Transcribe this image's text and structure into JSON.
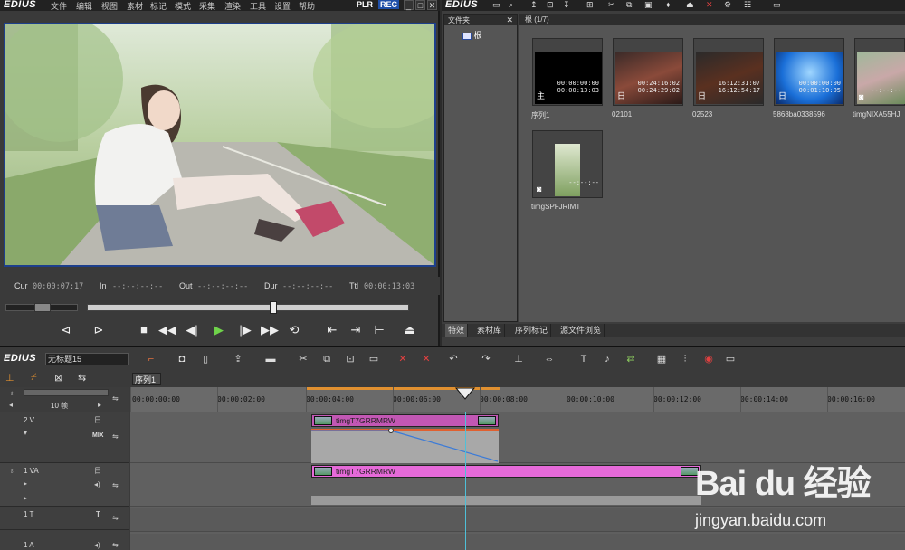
{
  "player": {
    "brand": "EDIUS",
    "menu": [
      "文件",
      "编辑",
      "视图",
      "素材",
      "标记",
      "模式",
      "采集",
      "渲染",
      "工具",
      "设置",
      "帮助"
    ],
    "plr": "PLR",
    "rec": "REC",
    "timecodes": [
      {
        "label": "Cur",
        "value": "00:00:07:17"
      },
      {
        "label": "In",
        "value": "--:--:--:--"
      },
      {
        "label": "Out",
        "value": "--:--:--:--"
      },
      {
        "label": "Dur",
        "value": "--:--:--:--"
      },
      {
        "label": "Ttl",
        "value": "00:00:13:03"
      }
    ]
  },
  "bin": {
    "brand": "EDIUS",
    "folder_header": "文件夹",
    "folder_root": "根",
    "bin_header": "根 (1/7)",
    "clips": [
      {
        "name": "序列1",
        "tc_top": "00:00:00:00",
        "tc_bottom": "00:00:13:03",
        "kind": "主"
      },
      {
        "name": "02101",
        "tc_top": "00:24:16:02",
        "tc_bottom": "00:24:29:02",
        "kind": "日"
      },
      {
        "name": "02523",
        "tc_top": "16:12:31:07",
        "tc_bottom": "16:12:54:17",
        "kind": "日"
      },
      {
        "name": "5868ba0338596",
        "tc_top": "00:00:00:00",
        "tc_bottom": "00:01:10:05",
        "kind": "日"
      },
      {
        "name": "timgNIXA55HJ",
        "tc_top": "",
        "tc_bottom": "--:--:--",
        "kind": "◙"
      },
      {
        "name": "timgSPFJRIMT",
        "tc_top": "",
        "tc_bottom": "--:--:--",
        "kind": "◙"
      }
    ],
    "tabs": [
      "特效",
      "素材库",
      "序列标记",
      "源文件浏览"
    ]
  },
  "timeline": {
    "brand": "EDIUS",
    "sequence_name": "无标题15",
    "sequence_tab": "序列1",
    "zoom_label": "10 帧",
    "ruler": [
      "00:00:00:00",
      "00:00:02:00",
      "00:00:04:00",
      "00:00:06:00",
      "00:00:08:00",
      "00:00:10:00",
      "00:00:12:00",
      "00:00:14:00",
      "00:00:16:00"
    ],
    "tracks": [
      {
        "name": "2 V",
        "clip": "timgT7GRRMRW"
      },
      {
        "name": "1 VA",
        "clip": "timgT7GRRMRW"
      },
      {
        "name": "1 T",
        "clip": ""
      },
      {
        "name": "1 A",
        "clip": ""
      }
    ],
    "mix_label": "MIX"
  },
  "watermark": {
    "logo": "Bai du 经验",
    "url": "jingyan.baidu.com"
  }
}
